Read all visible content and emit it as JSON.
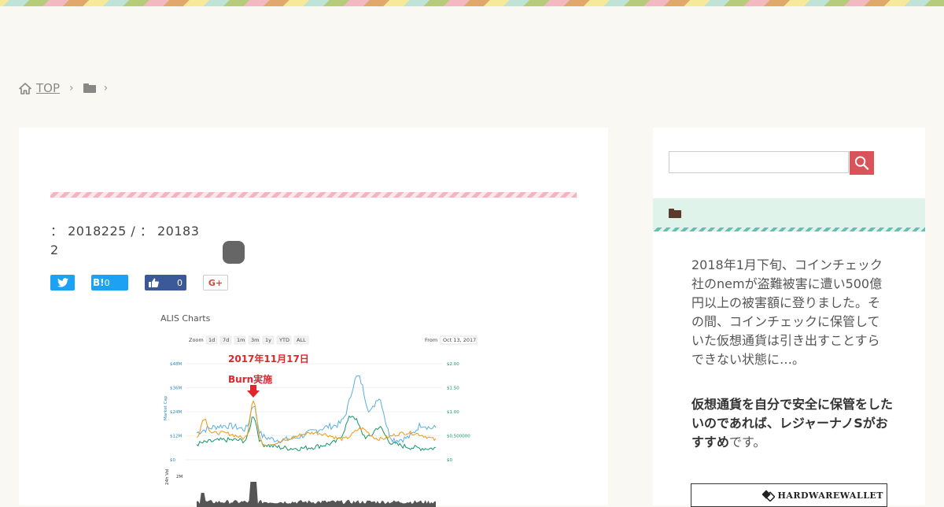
{
  "breadcrumb": {
    "home_label": " TOP",
    "category_label": ""
  },
  "post": {
    "meta_line1": "： 2018225 / ： 20183",
    "meta_line2": "2"
  },
  "share": {
    "twitter_icon": "twitter-bird-icon",
    "hatena_label": "B!",
    "hatena_count": "0",
    "facebook_count": "0",
    "googleplus_label": "G+"
  },
  "chart_image": {
    "type": "line",
    "title": "ALIS Charts",
    "zoom_label": "Zoom",
    "zoom_options": [
      "1d",
      "7d",
      "1m",
      "3m",
      "1y",
      "YTD",
      "ALL"
    ],
    "from_label": "From",
    "from_date": "Oct 13, 2017",
    "annotation_date": "2017年11月17日",
    "annotation_text": "Burn実施",
    "left_axis_label": "Market Cap",
    "left_ticks": [
      "$0",
      "$12M",
      "$24M",
      "$36M",
      "$48M"
    ],
    "right_ticks": [
      "$0",
      "$0.500000",
      "$1.00",
      "$1.50",
      "$2.00"
    ],
    "volume_axis_label": "24h Vol",
    "volume_ticks": [
      "2M"
    ],
    "colors": {
      "market_cap": "#5aaee0",
      "price_usd": "#12966a",
      "price_btc": "#f0a020",
      "annotation": "#e0262b"
    }
  },
  "sidebar": {
    "search_placeholder": "",
    "search_icon": "magnifier-icon",
    "widget_icon": "folder-icon",
    "para1": "2018年1月下旬、コインチェック社のnemが盗難被害に遭い500億円以上の被害額に登りました。その間、コインチェックに保管していた仮想通貨は引き出すことすらできない状態に…。",
    "para2_bold": "仮想通貨を自分で安全に保管をしたいのであれば、レジャーナノSがおすすめ",
    "para2_tail": "です。",
    "banner_text": "HARDWAREWALLET"
  },
  "colors": {
    "accent_red": "#d9535b",
    "mint": "#dff3eb",
    "pink_stripe": "#f4b4c1",
    "twitter": "#1da1f2",
    "facebook": "#3b5998"
  }
}
